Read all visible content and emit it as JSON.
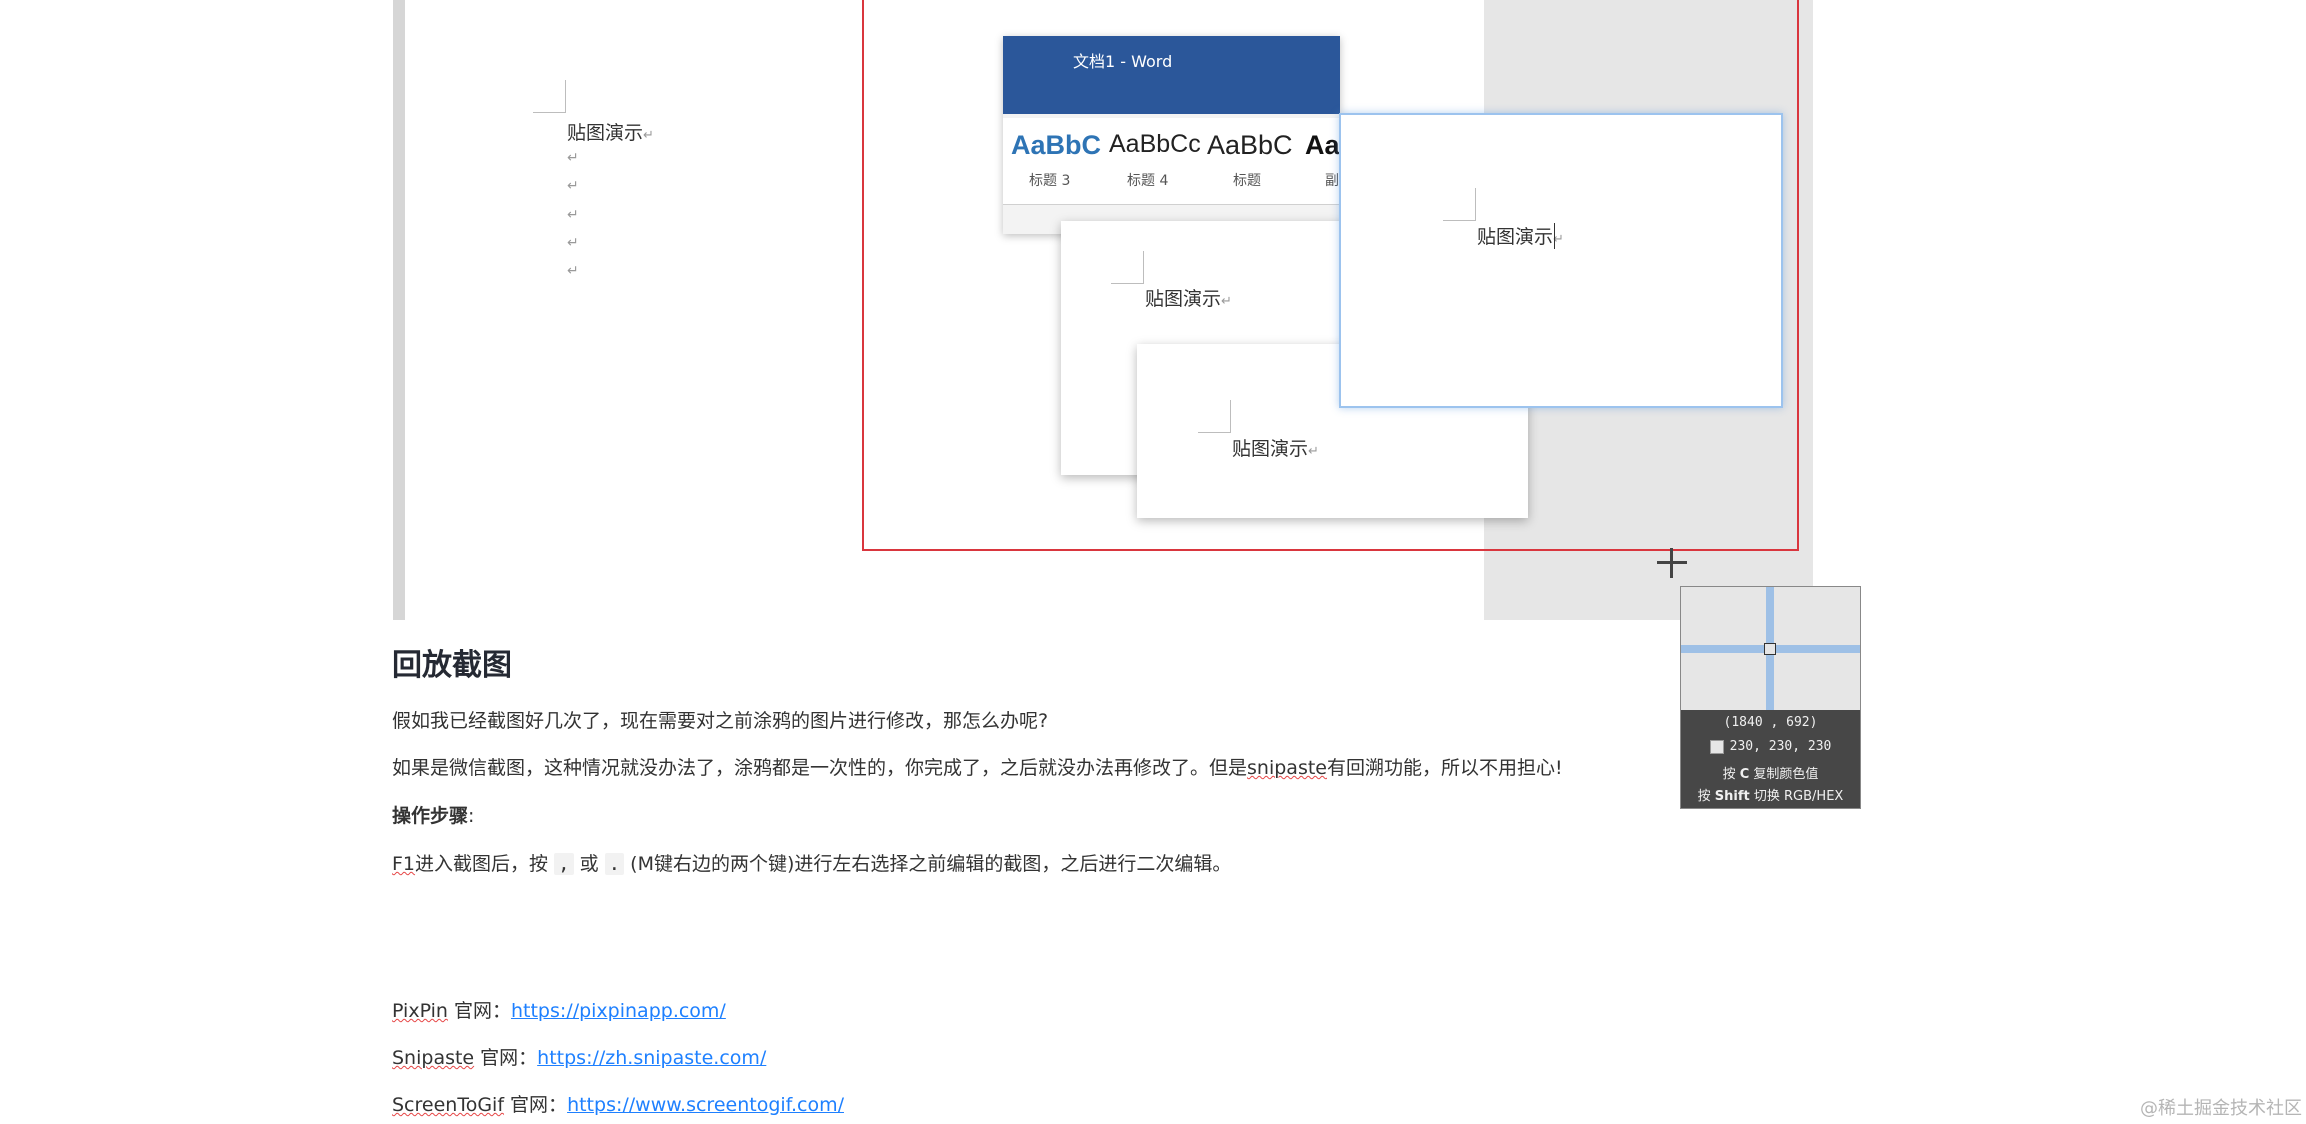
{
  "screenshot": {
    "demo_text": "贴图演示",
    "para_mark": "↵",
    "word": {
      "title": "文档1 - Word",
      "styles": [
        {
          "sample": "AaBbC",
          "name": "标题 3",
          "color": "#2e74b5",
          "bold": true
        },
        {
          "sample": "AaBbCc",
          "name": "标题 4",
          "color": "#222222",
          "bold": false
        },
        {
          "sample": "AaBbC",
          "name": "标题",
          "color": "#222222",
          "bold": false
        },
        {
          "sample": "Aa",
          "name": "副",
          "color": "#111111",
          "bold": true
        }
      ]
    }
  },
  "magnifier": {
    "coord": "(1840 , 692)",
    "rgb": "230, 230, 230",
    "hint1_pre": "按 ",
    "hint1_key": "C",
    "hint1_post": " 复制颜色值",
    "hint2_pre": "按 ",
    "hint2_key": "Shift",
    "hint2_post": " 切换 RGB/HEX"
  },
  "article": {
    "heading": "回放截图",
    "p1": "假如我已经截图好几次了，现在需要对之前涂鸦的图片进行修改，那怎么办呢?",
    "p2_pre": "如果是微信截图，这种情况就没办法了，涂鸦都是一次性的，你完成了，之后就没办法再修改了。但是",
    "p2_word": "snipaste",
    "p2_post": "有回溯功能，所以不用担心!",
    "steps_label": "操作步骤",
    "steps_colon": ":",
    "p4_f1": "F1",
    "p4_a": "进入截图后，按",
    "p4_k1": ",",
    "p4_b": "或",
    "p4_k2": ".",
    "p4_c": "(M键右边的两个键)进行左右选择之前编辑的截图，之后进行二次编辑。",
    "links": [
      {
        "name": "PixPin",
        "label": " 官网：",
        "url": "https://pixpinapp.com/"
      },
      {
        "name": "Snipaste",
        "label": " 官网：",
        "url": "https://zh.snipaste.com/"
      },
      {
        "name": "ScreenToGif",
        "label": " 官网：",
        "url": "https://www.screentogif.com/"
      }
    ]
  },
  "watermark": "@稀土掘金技术社区"
}
